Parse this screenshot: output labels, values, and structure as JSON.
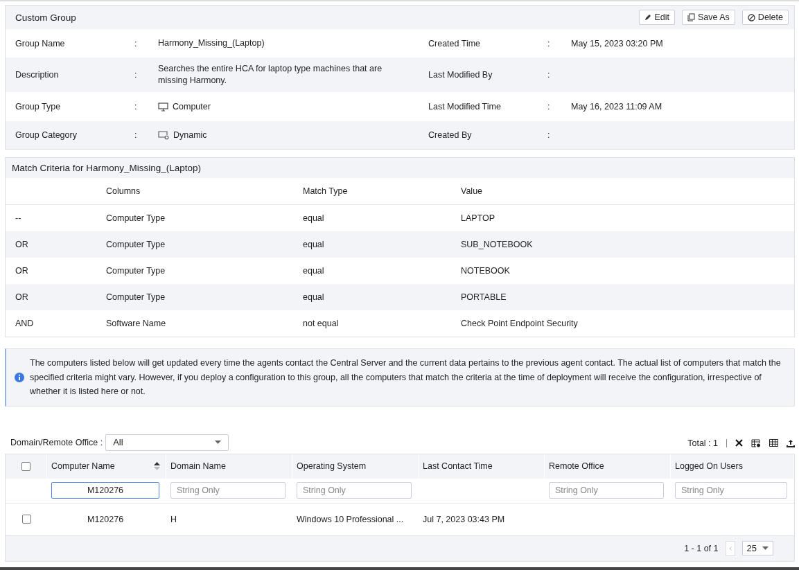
{
  "panel": {
    "title": "Custom Group",
    "actions": [
      {
        "kind": "edit",
        "label": "Edit"
      },
      {
        "kind": "copy",
        "label": "Save As"
      },
      {
        "kind": "delete",
        "label": "Delete"
      }
    ]
  },
  "details": [
    {
      "label": "Group Name",
      "colon": ":",
      "value": "Harmony_Missing_(Laptop)",
      "label2": "Created Time",
      "colon2": ":",
      "value2": "May 15, 2023 03:20 PM"
    },
    {
      "label": "Description",
      "colon": ":",
      "value": "Searches the entire HCA for laptop type machines that are missing Harmony.",
      "label2": "Last Modified By",
      "colon2": ":"
    },
    {
      "label": "Group Type",
      "colon": ":",
      "value": "Computer",
      "kind": "monitor",
      "label2": "Last Modified Time",
      "colon2": ":",
      "value2": "May 16, 2023 11:09 AM"
    },
    {
      "label": "Group Category",
      "colon": ":",
      "value": "Dynamic",
      "kind": "dynamic",
      "label2": "Created By",
      "colon2": ":"
    }
  ],
  "criteria": {
    "title": "Match Criteria for Harmony_Missing_(Laptop)",
    "columns": [
      "Columns",
      "Match Type",
      "Value"
    ],
    "rows": [
      {
        "operator": "--",
        "column": "Computer Type",
        "match": "equal",
        "value": "LAPTOP"
      },
      {
        "operator": "OR",
        "column": "Computer Type",
        "match": "equal",
        "value": "SUB_NOTEBOOK"
      },
      {
        "operator": "OR",
        "column": "Computer Type",
        "match": "equal",
        "value": "NOTEBOOK"
      },
      {
        "operator": "OR",
        "column": "Computer Type",
        "match": "equal",
        "value": "PORTABLE"
      },
      {
        "operator": "AND",
        "column": "Software Name",
        "match": "not equal",
        "value": "Check Point Endpoint Security"
      }
    ]
  },
  "info": "The computers listed below will get updated every time the agents contact the Central Server and the current data pertains to the previous agent contact. The actual list of computers that match the specified criteria might vary. However, if you deploy a configuration to this group, all the computers that match the criteria at the time of deployment will receive the configuration, irrespective of whether it is listed here or not.",
  "computers": {
    "filter_label": "Domain/Remote Office :",
    "filter_value": "All",
    "total": "Total : 1",
    "header_checked": false,
    "columns": [
      {
        "label": "Computer Name",
        "sortable": true
      },
      {
        "label": "Domain Name",
        "sortable": false
      },
      {
        "label": "Operating System",
        "sortable": false
      },
      {
        "label": "Last Contact Time",
        "sortable": false
      },
      {
        "label": "Remote Office",
        "sortable": false
      },
      {
        "label": "Logged On Users",
        "sortable": false
      }
    ],
    "filters": [
      {
        "kind": "input",
        "value": "M120276"
      },
      {
        "kind": "input",
        "placeholder": "String Only"
      },
      {
        "kind": "input",
        "placeholder": "String Only"
      },
      {
        "kind": "none"
      },
      {
        "kind": "input",
        "placeholder": "String Only"
      },
      {
        "kind": "input",
        "placeholder": "String Only"
      }
    ],
    "rows": [
      {
        "checked": false,
        "cells": [
          "M120276",
          "H",
          "Windows 10 Professional ...",
          "Jul 7, 2023 03:43 PM"
        ]
      }
    ],
    "pagination": {
      "range": "1 - 1 of 1",
      "page_size": "25"
    }
  }
}
